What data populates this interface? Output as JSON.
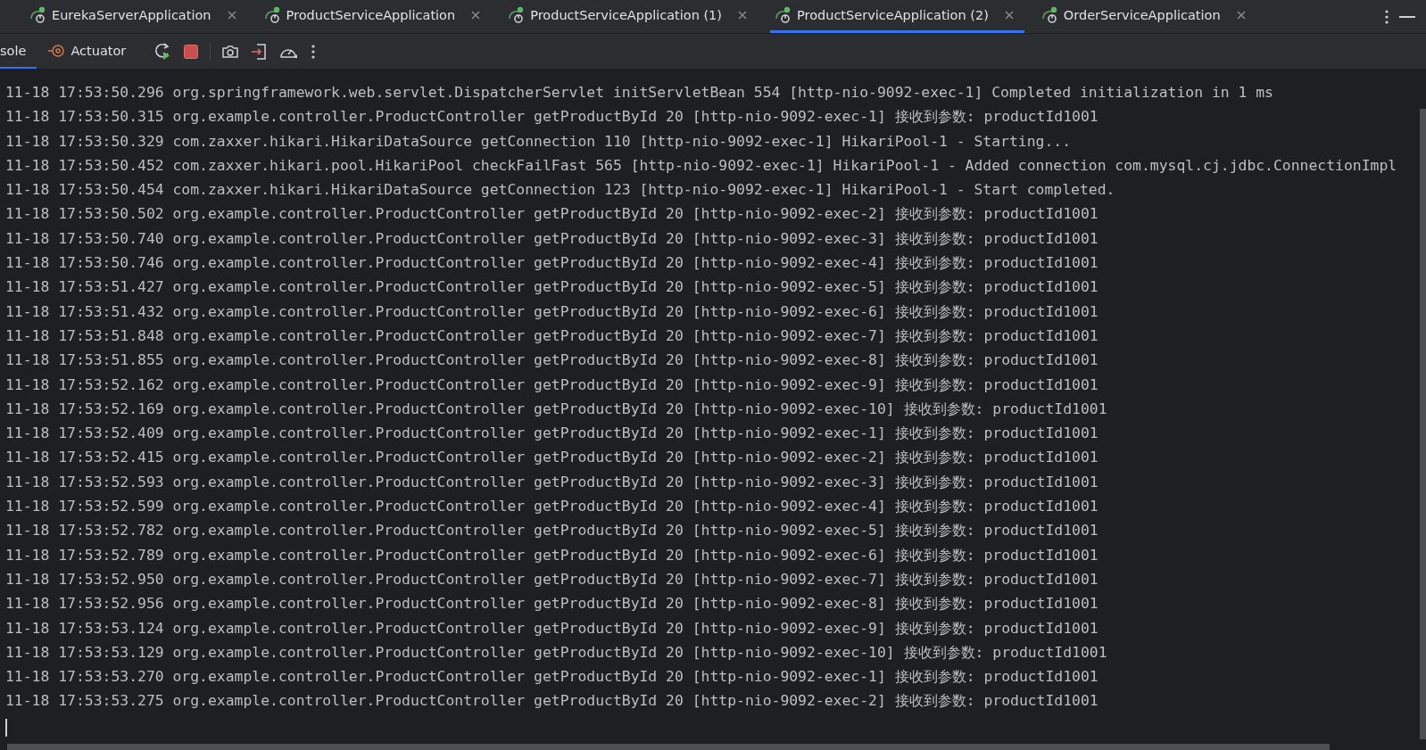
{
  "tabs": [
    {
      "label": "EurekaServerApplication",
      "selected": false
    },
    {
      "label": "ProductServiceApplication",
      "selected": false
    },
    {
      "label": "ProductServiceApplication (1)",
      "selected": false
    },
    {
      "label": "ProductServiceApplication (2)",
      "selected": true
    },
    {
      "label": "OrderServiceApplication",
      "selected": false
    }
  ],
  "toolbar": {
    "views": [
      {
        "label": "sole",
        "selected": true,
        "kind": "text"
      },
      {
        "label": "Actuator",
        "selected": false,
        "kind": "actuator"
      }
    ]
  },
  "console": {
    "lines": [
      "11-18 17:53:50.296 org.springframework.web.servlet.DispatcherServlet initServletBean 554 [http-nio-9092-exec-1] Completed initialization in 1 ms",
      "11-18 17:53:50.315 org.example.controller.ProductController getProductById 20 [http-nio-9092-exec-1] 接收到参数: productId1001",
      "11-18 17:53:50.329 com.zaxxer.hikari.HikariDataSource getConnection 110 [http-nio-9092-exec-1] HikariPool-1 - Starting...",
      "11-18 17:53:50.452 com.zaxxer.hikari.pool.HikariPool checkFailFast 565 [http-nio-9092-exec-1] HikariPool-1 - Added connection com.mysql.cj.jdbc.ConnectionImpl",
      "11-18 17:53:50.454 com.zaxxer.hikari.HikariDataSource getConnection 123 [http-nio-9092-exec-1] HikariPool-1 - Start completed.",
      "11-18 17:53:50.502 org.example.controller.ProductController getProductById 20 [http-nio-9092-exec-2] 接收到参数: productId1001",
      "11-18 17:53:50.740 org.example.controller.ProductController getProductById 20 [http-nio-9092-exec-3] 接收到参数: productId1001",
      "11-18 17:53:50.746 org.example.controller.ProductController getProductById 20 [http-nio-9092-exec-4] 接收到参数: productId1001",
      "11-18 17:53:51.427 org.example.controller.ProductController getProductById 20 [http-nio-9092-exec-5] 接收到参数: productId1001",
      "11-18 17:53:51.432 org.example.controller.ProductController getProductById 20 [http-nio-9092-exec-6] 接收到参数: productId1001",
      "11-18 17:53:51.848 org.example.controller.ProductController getProductById 20 [http-nio-9092-exec-7] 接收到参数: productId1001",
      "11-18 17:53:51.855 org.example.controller.ProductController getProductById 20 [http-nio-9092-exec-8] 接收到参数: productId1001",
      "11-18 17:53:52.162 org.example.controller.ProductController getProductById 20 [http-nio-9092-exec-9] 接收到参数: productId1001",
      "11-18 17:53:52.169 org.example.controller.ProductController getProductById 20 [http-nio-9092-exec-10] 接收到参数: productId1001",
      "11-18 17:53:52.409 org.example.controller.ProductController getProductById 20 [http-nio-9092-exec-1] 接收到参数: productId1001",
      "11-18 17:53:52.415 org.example.controller.ProductController getProductById 20 [http-nio-9092-exec-2] 接收到参数: productId1001",
      "11-18 17:53:52.593 org.example.controller.ProductController getProductById 20 [http-nio-9092-exec-3] 接收到参数: productId1001",
      "11-18 17:53:52.599 org.example.controller.ProductController getProductById 20 [http-nio-9092-exec-4] 接收到参数: productId1001",
      "11-18 17:53:52.782 org.example.controller.ProductController getProductById 20 [http-nio-9092-exec-5] 接收到参数: productId1001",
      "11-18 17:53:52.789 org.example.controller.ProductController getProductById 20 [http-nio-9092-exec-6] 接收到参数: productId1001",
      "11-18 17:53:52.950 org.example.controller.ProductController getProductById 20 [http-nio-9092-exec-7] 接收到参数: productId1001",
      "11-18 17:53:52.956 org.example.controller.ProductController getProductById 20 [http-nio-9092-exec-8] 接收到参数: productId1001",
      "11-18 17:53:53.124 org.example.controller.ProductController getProductById 20 [http-nio-9092-exec-9] 接收到参数: productId1001",
      "11-18 17:53:53.129 org.example.controller.ProductController getProductById 20 [http-nio-9092-exec-10] 接收到参数: productId1001",
      "11-18 17:53:53.270 org.example.controller.ProductController getProductById 20 [http-nio-9092-exec-1] 接收到参数: productId1001",
      "11-18 17:53:53.275 org.example.controller.ProductController getProductById 20 [http-nio-9092-exec-2] 接收到参数: productId1001"
    ]
  }
}
